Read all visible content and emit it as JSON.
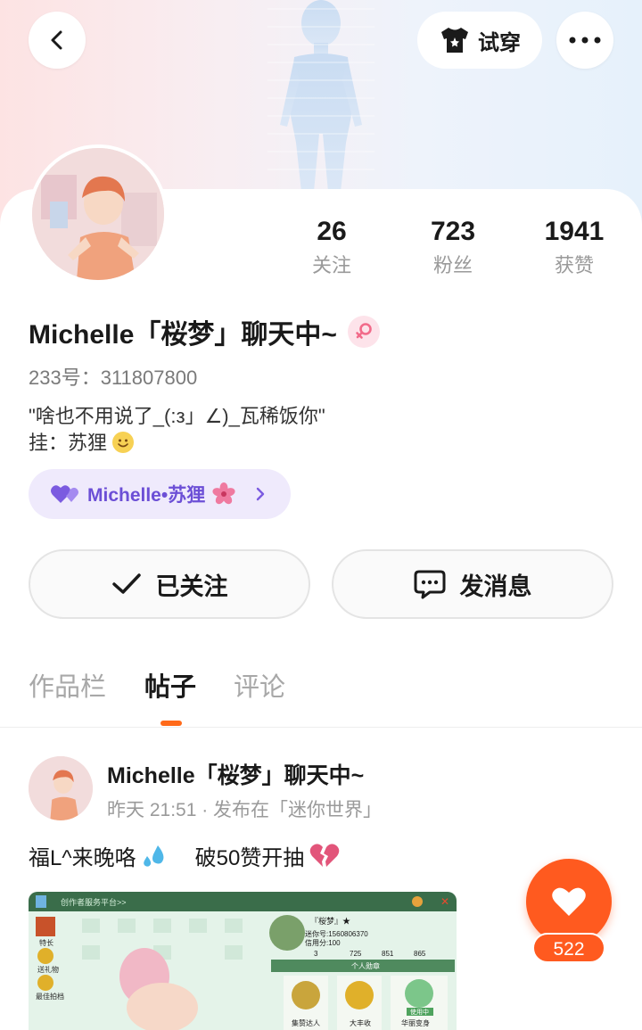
{
  "header": {
    "tryon_label": "试穿"
  },
  "profile": {
    "stats": [
      {
        "value": "26",
        "label": "关注"
      },
      {
        "value": "723",
        "label": "粉丝"
      },
      {
        "value": "1941",
        "label": "获赞"
      }
    ],
    "username": "Michelle「桜梦」聊天中~",
    "uid": "233号：311807800",
    "bio_line1": "\"啥也不用说了_(:з」∠)_瓦稀饭你\"",
    "bio_line2": "挂：苏狸",
    "tag_label": "Michelle•苏狸",
    "follow_label": "已关注",
    "message_label": "发消息"
  },
  "tabs": [
    {
      "label": "作品栏"
    },
    {
      "label": "帖子"
    },
    {
      "label": "评论"
    }
  ],
  "post": {
    "author": "Michelle「桜梦」聊天中~",
    "meta": "昨天 21:51 · 发布在「迷你世界」",
    "text": "福L^来晚咯",
    "text2": "破50赞开抽",
    "like_count": "522",
    "image": {
      "topbar_text": "创作者服务平台>>",
      "card_name": "『桜梦』★",
      "card_uid": "迷你号:1560806370",
      "credit": "信用分:100",
      "counts": [
        "3",
        "725",
        "851",
        "865"
      ],
      "medal_title": "个人勋章",
      "side_labels": [
        "特长",
        "送礼物",
        "最佳拍档"
      ],
      "medals": [
        "集赞达人",
        "大丰收",
        "华丽变身"
      ],
      "medal_badge": "使用中"
    }
  },
  "colors": {
    "accent": "#ff5a1f",
    "tag_bg": "#efeafc",
    "tag_text": "#6c4fd6"
  }
}
